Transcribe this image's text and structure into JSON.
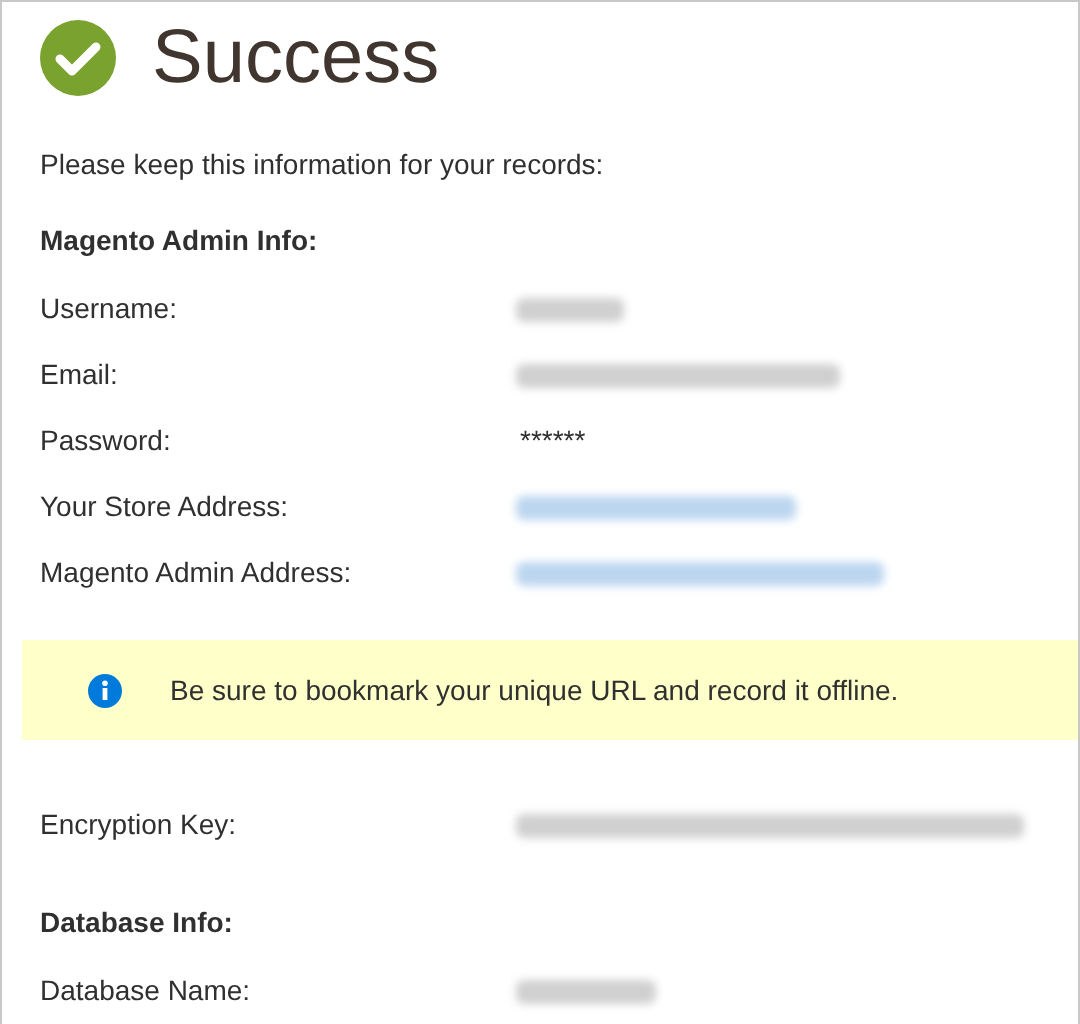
{
  "title": "Success",
  "intro": "Please keep this information for your records:",
  "admin_section": {
    "heading": "Magento Admin Info:",
    "rows": [
      {
        "label": "Username:",
        "redacted": true,
        "kind": "text"
      },
      {
        "label": "Email:",
        "redacted": true,
        "kind": "text"
      },
      {
        "label": "Password:",
        "redacted": false,
        "kind": "text",
        "value": "******"
      },
      {
        "label": "Your Store Address:",
        "redacted": true,
        "kind": "link"
      },
      {
        "label": "Magento Admin Address:",
        "redacted": true,
        "kind": "link"
      }
    ]
  },
  "notice": {
    "text": "Be sure to bookmark your unique URL and record it offline."
  },
  "encryption_row": {
    "label": "Encryption Key:",
    "redacted": true,
    "kind": "text"
  },
  "database_section": {
    "heading": "Database Info:",
    "rows": [
      {
        "label": "Database Name:",
        "redacted": true,
        "kind": "text"
      }
    ]
  }
}
